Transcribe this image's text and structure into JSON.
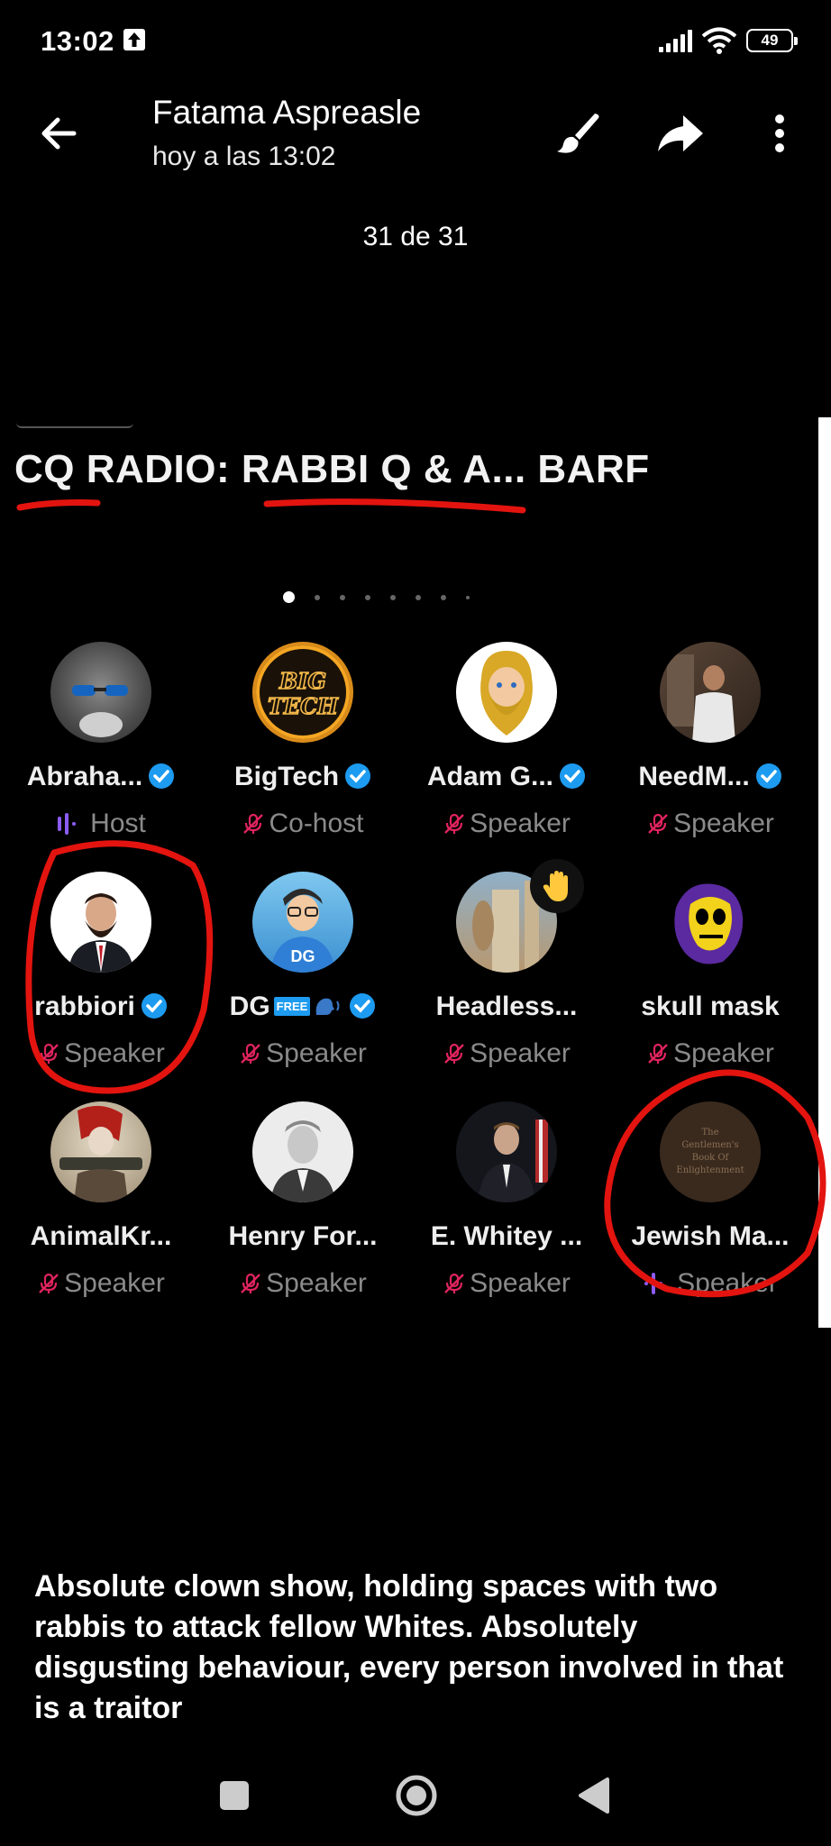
{
  "status_bar": {
    "time": "13:02",
    "battery": "49",
    "icons": [
      "upload-icon",
      "signal-icon",
      "wifi-icon",
      "battery-icon"
    ]
  },
  "header": {
    "sender": "Fatama Aspreasle",
    "timestamp": "hoy a las 13:02",
    "counter": "31 de 31",
    "icons": [
      "back-arrow-icon",
      "brush-icon",
      "share-icon",
      "more-vert-icon"
    ]
  },
  "space": {
    "title": "CQ RADIO: RABBI Q & A... BARF",
    "pager_dots": 8,
    "participants": [
      {
        "name": "Abraha...",
        "role": "Host",
        "verified": true,
        "role_icon": "audio-wave-icon"
      },
      {
        "name": "BigTech",
        "role": "Co-host",
        "verified": true,
        "role_icon": "mic-off-icon",
        "avatar_text": "BIG TECH"
      },
      {
        "name": "Adam G...",
        "role": "Speaker",
        "verified": true,
        "role_icon": "mic-off-icon"
      },
      {
        "name": "NeedM...",
        "role": "Speaker",
        "verified": true,
        "role_icon": "mic-off-icon"
      },
      {
        "name": "rabbiori",
        "role": "Speaker",
        "verified": true,
        "role_icon": "mic-off-icon"
      },
      {
        "name": "DG",
        "badge": "FREE",
        "role": "Speaker",
        "verified": true,
        "role_icon": "mic-off-icon",
        "avatar_text": "DG"
      },
      {
        "name": "Headless...",
        "role": "Speaker",
        "verified": false,
        "role_icon": "mic-off-icon",
        "hand_raised": true
      },
      {
        "name": "skull mask",
        "role": "Speaker",
        "verified": false,
        "role_icon": "mic-off-icon"
      },
      {
        "name": "AnimalKr...",
        "role": "Speaker",
        "verified": false,
        "role_icon": "mic-off-icon"
      },
      {
        "name": "Henry For...",
        "role": "Speaker",
        "verified": false,
        "role_icon": "mic-off-icon"
      },
      {
        "name": "E. Whitey ...",
        "role": "Speaker",
        "verified": false,
        "role_icon": "mic-off-icon"
      },
      {
        "name": "Jewish Ma...",
        "role": "Speaker",
        "verified": false,
        "role_icon": "audio-wave-icon",
        "avatar_text": "The Gentlemen's Book Of Enlightenment"
      }
    ]
  },
  "caption": "Absolute clown show, holding spaces with two rabbis to attack fellow Whites. Absolutely disgusting behaviour, every person involved in that is a traitor",
  "colors": {
    "background": "#000000",
    "annotation_red": "#e3140f",
    "verified_blue": "#1d9bf0",
    "speaking_purple": "#8b5cf6",
    "mic_off_red": "#e0245e"
  }
}
